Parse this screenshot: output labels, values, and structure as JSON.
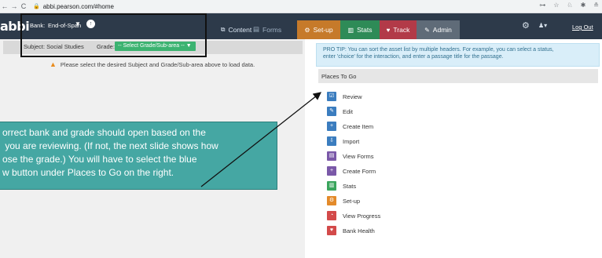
{
  "browser": {
    "back": "←",
    "forward": "→",
    "reload": "C",
    "url": "abbi.pearson.com/#home",
    "right_icons": [
      "⊶",
      "☆",
      "♘",
      "✱",
      "≗"
    ]
  },
  "app": {
    "logo": "abbi",
    "bank_label": "Bank:",
    "bank_value": "End-of-Span",
    "bank_caret": "▼",
    "bank_upload": "↑",
    "tabs": {
      "content": "Content",
      "forms": "Forms",
      "setup": "Set-up",
      "stats": "Stats",
      "track": "Track",
      "admin": "Admin"
    },
    "user_menu": "♟▾",
    "logout": "Log Out"
  },
  "left": {
    "subject_text": "Subject: Social Studies",
    "grade_label": "Grade:",
    "grade_select": "-- Select Grade/Sub-area --  ▼",
    "warning": "Please select the desired Subject and Grade/Sub-area above to load data."
  },
  "callout": {
    "text": "orrect bank and grade should open based on the\n you are reviewing. (If not, the next slide shows how\nose the grade.) You will have to select the blue\nw button under Places to Go on the right."
  },
  "right": {
    "pro_tip": "PRO TIP: You can sort the asset list by multiple headers. For example, you can select a status,\nenter 'choice' for the interaction, and enter a passage title for the passage.",
    "places_header": "Places To Go",
    "places": [
      {
        "label": "Review",
        "color": "#3b7dbf",
        "glyph": "☑"
      },
      {
        "label": "Edit",
        "color": "#3b7dbf",
        "glyph": "✎"
      },
      {
        "label": "Create Item",
        "color": "#3b7dbf",
        "glyph": "+"
      },
      {
        "label": "Import",
        "color": "#3b7dbf",
        "glyph": "⇩"
      },
      {
        "label": "View Forms",
        "color": "#7a58a8",
        "glyph": "▤"
      },
      {
        "label": "Create Form",
        "color": "#7a58a8",
        "glyph": "+"
      },
      {
        "label": "Stats",
        "color": "#3aa55d",
        "glyph": "▥"
      },
      {
        "label": "Set-up",
        "color": "#e38a2a",
        "glyph": "⚙"
      },
      {
        "label": "View Progress",
        "color": "#d34a4a",
        "glyph": "◔"
      },
      {
        "label": "Bank Health",
        "color": "#d34a4a",
        "glyph": "♥"
      }
    ]
  }
}
